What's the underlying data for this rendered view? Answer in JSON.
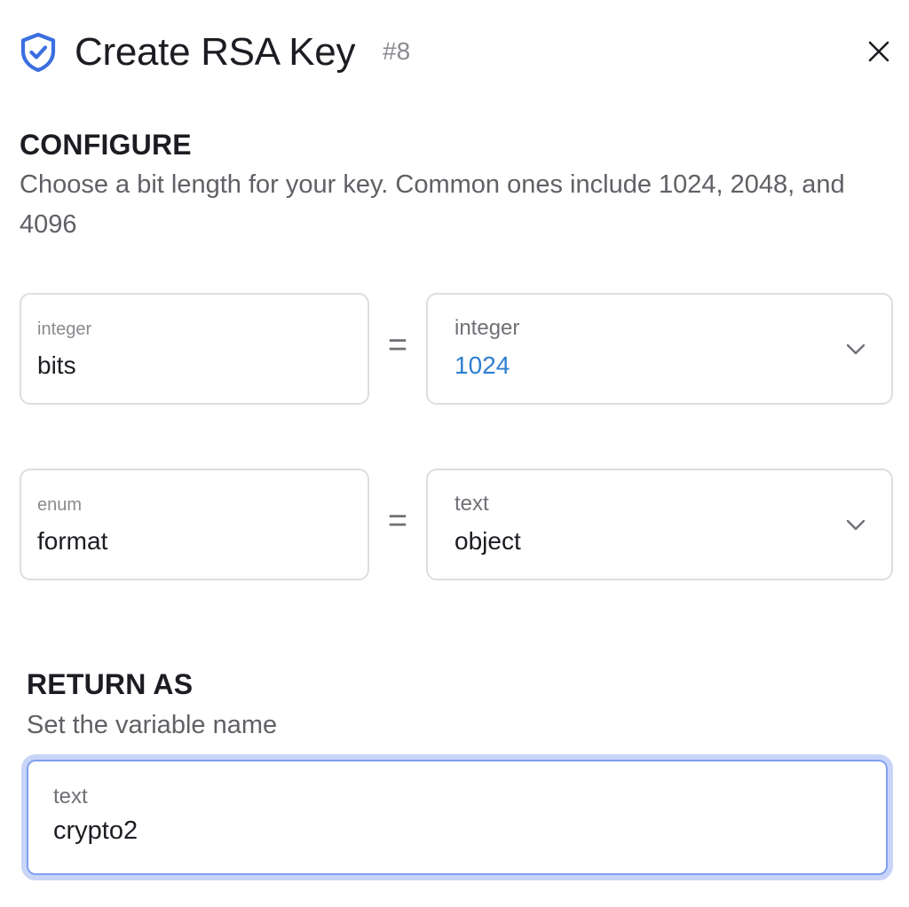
{
  "header": {
    "title": "Create RSA Key",
    "step": "#8",
    "accent_color": "#3b6fe0",
    "icon": "shield-check-icon",
    "close_icon": "close-icon"
  },
  "configure": {
    "title": "CONFIGURE",
    "description": "Choose a bit length for your key. Common ones include 1024, 2048, and 4096",
    "params": [
      {
        "name_type": "integer",
        "name": "bits",
        "value_type": "integer",
        "value": "1024",
        "value_color": "#2f7fd1"
      },
      {
        "name_type": "enum",
        "name": "format",
        "value_type": "text",
        "value": "object"
      }
    ],
    "equals": "="
  },
  "return_as": {
    "title": "RETURN AS",
    "description": "Set the variable name",
    "type": "text",
    "value": "crypto2"
  }
}
